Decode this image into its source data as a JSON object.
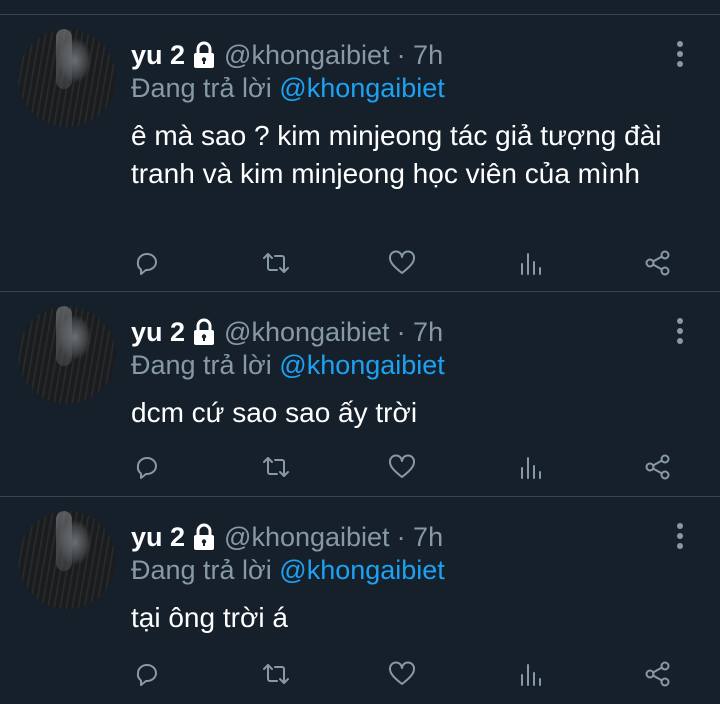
{
  "colors": {
    "background": "#15202b",
    "divider": "#38444d",
    "muted": "#8899a6",
    "mention": "#1da1f2"
  },
  "tweets": [
    {
      "author": "yu 2",
      "handle": "@khongaibiet",
      "time": "· 7h",
      "reply_prefix": "Đang trả lời",
      "reply_to": "@khongaibiet",
      "text": "ê mà sao ? kim minjeong tác giả tượng đài tranh và kim minjeong học viên của mình",
      "icons": [
        "lock-icon",
        "more-icon",
        "reply-icon",
        "retweet-icon",
        "like-icon",
        "analytics-icon",
        "share-icon"
      ]
    },
    {
      "author": "yu 2",
      "handle": "@khongaibiet",
      "time": "· 7h",
      "reply_prefix": "Đang trả lời",
      "reply_to": "@khongaibiet",
      "text": "dcm cứ sao sao ấy trời",
      "icons": [
        "lock-icon",
        "more-icon",
        "reply-icon",
        "retweet-icon",
        "like-icon",
        "analytics-icon",
        "share-icon"
      ]
    },
    {
      "author": "yu 2",
      "handle": "@khongaibiet",
      "time": "· 7h",
      "reply_prefix": "Đang trả lời",
      "reply_to": "@khongaibiet",
      "text": "tại ông trời á",
      "icons": [
        "lock-icon",
        "more-icon",
        "reply-icon",
        "retweet-icon",
        "like-icon",
        "analytics-icon",
        "share-icon"
      ]
    }
  ]
}
